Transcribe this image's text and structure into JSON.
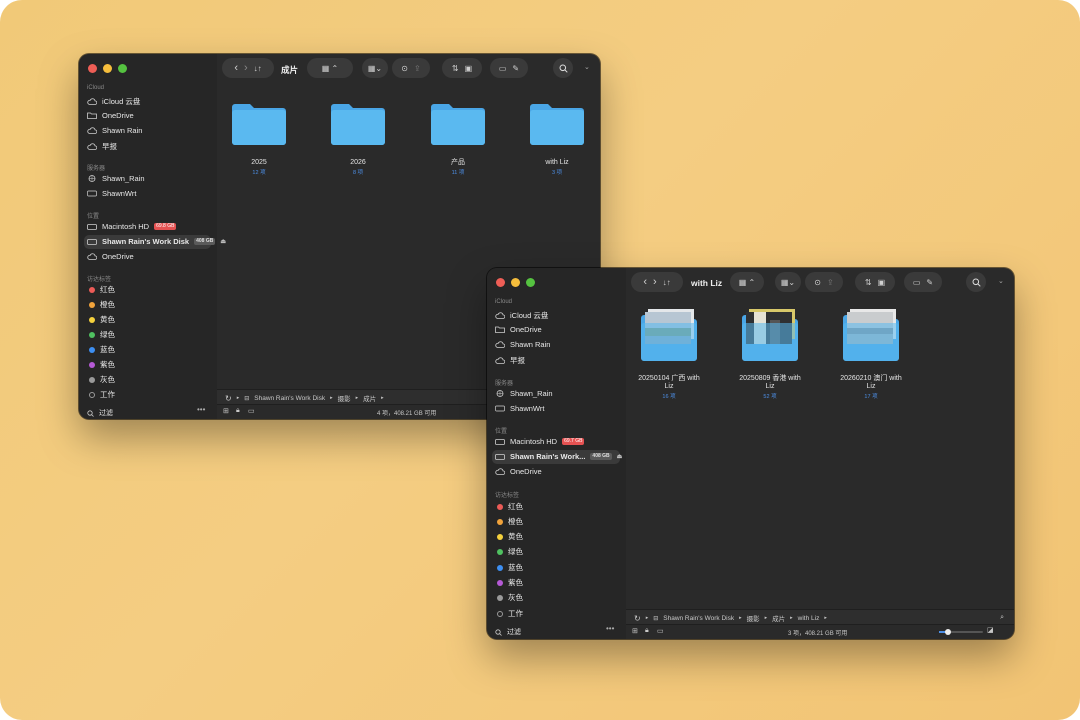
{
  "window1": {
    "title": "成片",
    "sidebar": {
      "icloud_header": "iCloud",
      "icloud_items": [
        "iCloud 云盘",
        "OneDrive",
        "Shawn Rain",
        "早报"
      ],
      "servers_header": "服务器",
      "servers": [
        "Shawn_Rain",
        "ShawnWrt"
      ],
      "locations_header": "位置",
      "locations": [
        {
          "label": "Macintosh HD",
          "badge": "69.8 GB"
        },
        {
          "label": "Shawn Rain's Work Disk",
          "badge": "408 GB"
        },
        {
          "label": "OneDrive",
          "badge": ""
        }
      ],
      "tags_header": "访达标签",
      "tags": [
        {
          "label": "红色",
          "color": "#ec5b57"
        },
        {
          "label": "橙色",
          "color": "#f1a33b"
        },
        {
          "label": "黄色",
          "color": "#f5d13d"
        },
        {
          "label": "绿色",
          "color": "#4fc160"
        },
        {
          "label": "蓝色",
          "color": "#3d8ff2"
        },
        {
          "label": "紫色",
          "color": "#b65ad6"
        },
        {
          "label": "灰色",
          "color": "#9a9a9a"
        },
        {
          "label": "工作",
          "color": "hollow"
        }
      ],
      "filter": "过滤"
    },
    "folders": [
      {
        "name": "2025",
        "count": "12 项"
      },
      {
        "name": "2026",
        "count": "8 项"
      },
      {
        "name": "产品",
        "count": "11 项"
      },
      {
        "name": "with Liz",
        "count": "3 项"
      }
    ],
    "path": [
      "Shawn Rain's Work Disk",
      "摄影",
      "成片"
    ],
    "status": "4 项，408.21 GB 可用"
  },
  "window2": {
    "title": "with Liz",
    "sidebar": {
      "icloud_header": "iCloud",
      "icloud_items": [
        "iCloud 云盘",
        "OneDrive",
        "Shawn Rain",
        "早报"
      ],
      "servers_header": "服务器",
      "servers": [
        "Shawn_Rain",
        "ShawnWrt"
      ],
      "locations_header": "位置",
      "locations": [
        {
          "label": "Macintosh HD",
          "badge": "69.7 GB"
        },
        {
          "label": "Shawn Rain's Work...",
          "badge": "408 GB"
        },
        {
          "label": "OneDrive",
          "badge": ""
        }
      ],
      "tags_header": "访达标签",
      "tags": [
        {
          "label": "红色",
          "color": "#ec5b57"
        },
        {
          "label": "橙色",
          "color": "#f1a33b"
        },
        {
          "label": "黄色",
          "color": "#f5d13d"
        },
        {
          "label": "绿色",
          "color": "#4fc160"
        },
        {
          "label": "蓝色",
          "color": "#3d8ff2"
        },
        {
          "label": "紫色",
          "color": "#b65ad6"
        },
        {
          "label": "灰色",
          "color": "#9a9a9a"
        },
        {
          "label": "工作",
          "color": "hollow"
        }
      ],
      "filter": "过滤"
    },
    "folders": [
      {
        "name_line1": "20250104 广西 with",
        "name_line2": "Liz",
        "count": "16 项"
      },
      {
        "name_line1": "20250809 香港 with",
        "name_line2": "Liz",
        "count": "52 项"
      },
      {
        "name_line1": "20260210 澳门 with",
        "name_line2": "Liz",
        "count": "17 项"
      }
    ],
    "path": [
      "Shawn Rain's Work Disk",
      "摄影",
      "成片",
      "with Liz"
    ],
    "status": "3 项，408.21 GB 可用",
    "zoom_level": 0.2
  },
  "colors": {
    "accent": "#4d8fe6",
    "folder": "#5ab4ee",
    "close": "#ee5e56",
    "minimize": "#f5bd3c",
    "zoom": "#55c240"
  }
}
